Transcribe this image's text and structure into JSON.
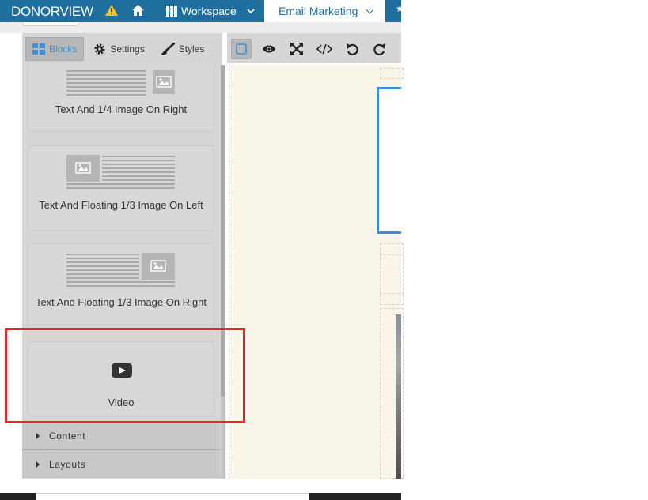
{
  "topnav": {
    "logo": "DONORVIEW",
    "workspace_label": "Workspace",
    "email_tab_label": "Email Marketing"
  },
  "panel_tabs": {
    "blocks": "Blocks",
    "settings": "Settings",
    "styles": "Styles"
  },
  "blocks": [
    {
      "label": "Text And 1/4 Image On Right"
    },
    {
      "label": "Text And Floating 1/3 Image On Left"
    },
    {
      "label": "Text And Floating 1/3 Image On Right"
    },
    {
      "label": "Video"
    }
  ],
  "accordion": {
    "content": "Content",
    "layouts": "Layouts"
  },
  "colors": {
    "nav": "#1f6f9e",
    "active_tab_text": "#3a8fd8",
    "highlight": "#e5262a",
    "selection": "#3b8fd6"
  }
}
